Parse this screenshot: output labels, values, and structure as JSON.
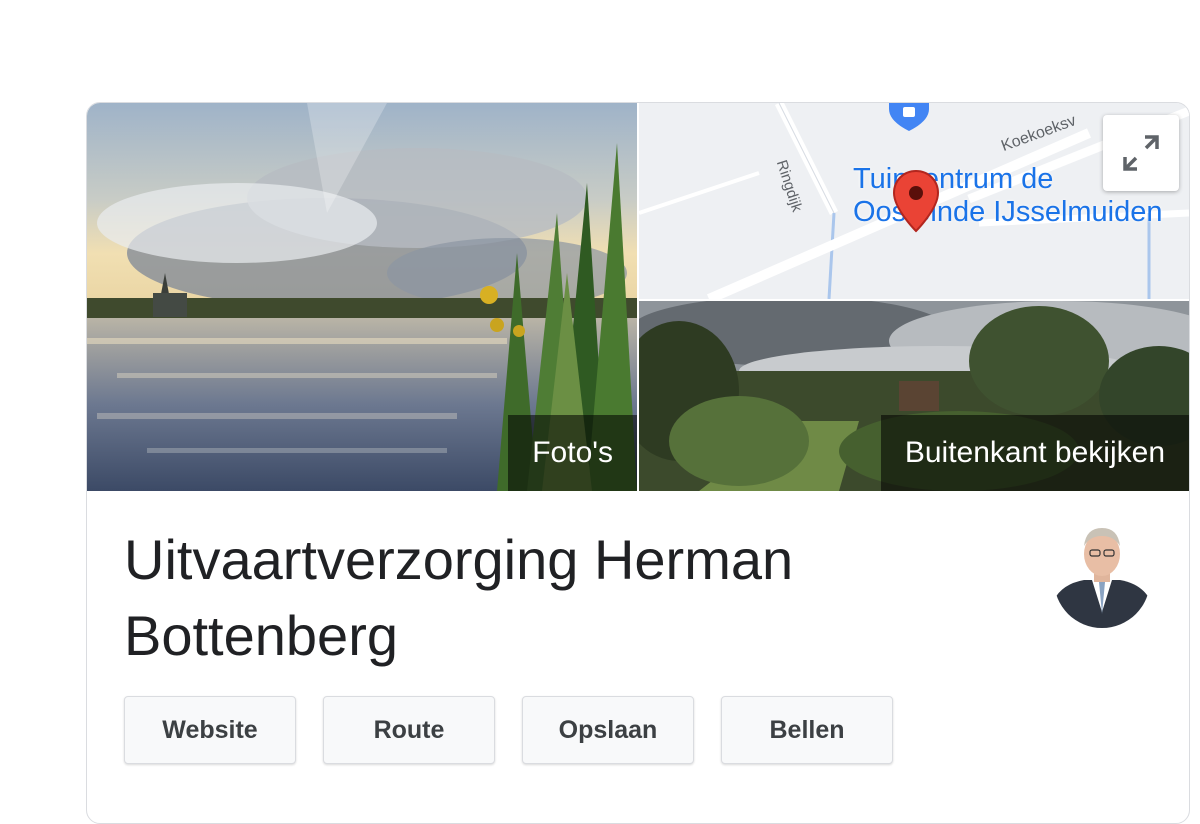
{
  "photos": {
    "main_label": "Foto's",
    "street_label": "Buitenkant bekijken"
  },
  "map": {
    "street_1": "Ringdijk",
    "street_2": "Koekoeksv",
    "place_line_1": "Tuincentrum de",
    "place_line_2": "Oosteinde IJsselmuiden",
    "expand_icon": "expand-icon",
    "pin_icon": "red-location-pin",
    "shop_icon": "blue-shopping-pin"
  },
  "business": {
    "name": "Uitvaartverzorging Herman Bottenberg"
  },
  "actions": [
    {
      "label": "Website"
    },
    {
      "label": "Route"
    },
    {
      "label": "Opslaan"
    },
    {
      "label": "Bellen"
    }
  ],
  "colors": {
    "title": "#202124",
    "button_text": "#3c4043",
    "map_text": "#1a73e8",
    "pin_red": "#ea4335"
  }
}
